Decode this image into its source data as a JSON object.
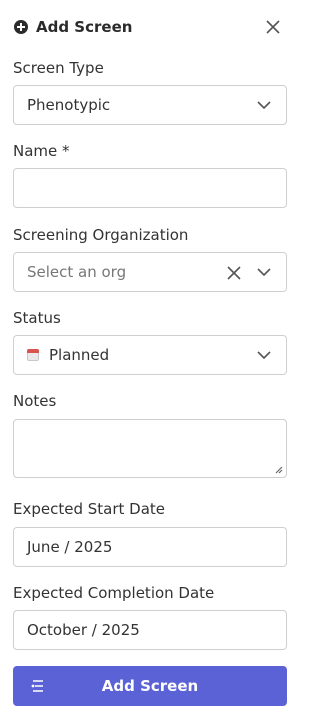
{
  "header": {
    "title": "Add Screen",
    "icon": "plus-circle-icon",
    "close_icon": "close-icon"
  },
  "fields": {
    "screen_type": {
      "label": "Screen Type",
      "value": "Phenotypic"
    },
    "name": {
      "label": "Name *",
      "value": ""
    },
    "org": {
      "label": "Screening Organization",
      "placeholder": "Select an org"
    },
    "status": {
      "label": "Status",
      "value": "Planned",
      "icon": "calendar-icon"
    },
    "notes": {
      "label": "Notes",
      "value": ""
    },
    "start_date": {
      "label": "Expected Start Date",
      "value": "June / 2025"
    },
    "completion_date": {
      "label": "Expected Completion Date",
      "value": "October / 2025"
    }
  },
  "submit": {
    "label": "Add Screen",
    "icon": "list-stack-icon",
    "color": "#5b62d6"
  }
}
